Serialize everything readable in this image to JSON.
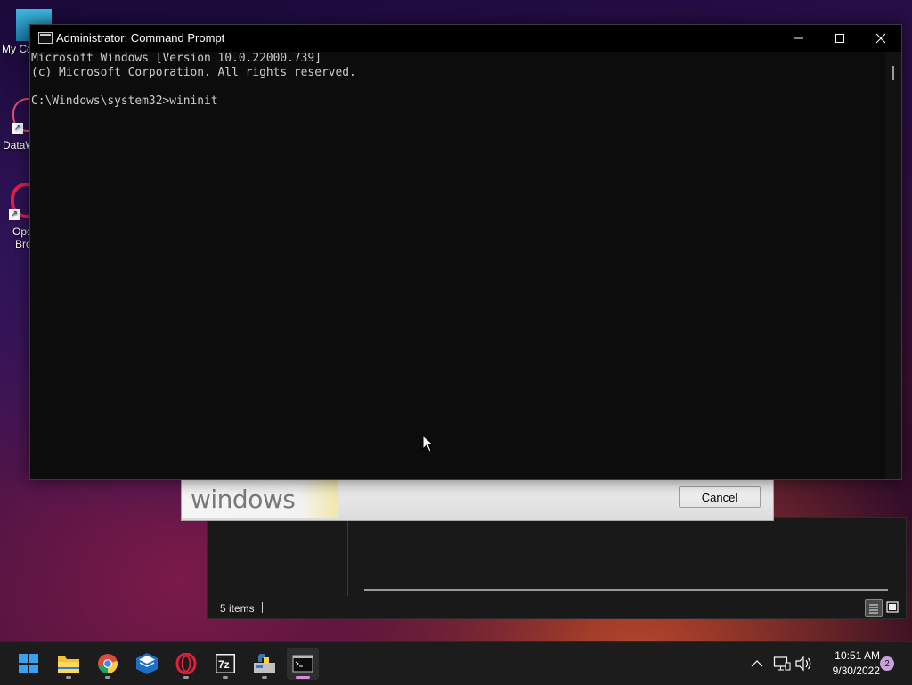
{
  "desktop": {
    "icons": [
      {
        "label": "My Co"
      },
      {
        "label": "DataW"
      },
      {
        "label": "Ope",
        "label2": "Bro"
      }
    ]
  },
  "explorer": {
    "status": "5 items"
  },
  "setup_dialog": {
    "logo_text": "windows",
    "cancel_label": "Cancel"
  },
  "cmd": {
    "title": "Administrator: Command Prompt",
    "lines": [
      "Microsoft Windows [Version 10.0.22000.739]",
      "(c) Microsoft Corporation. All rights reserved.",
      "",
      "C:\\Windows\\system32>wininit"
    ]
  },
  "taskbar": {
    "apps": [
      "start-icon",
      "file-explorer-icon",
      "chrome-icon",
      "virtualbox-icon",
      "opera-icon",
      "7zip-icon",
      "python-icon",
      "command-prompt-icon"
    ],
    "active_app": "command-prompt-icon",
    "clock_time": "10:51 AM",
    "clock_date": "9/30/2022",
    "notification_count": "2"
  }
}
